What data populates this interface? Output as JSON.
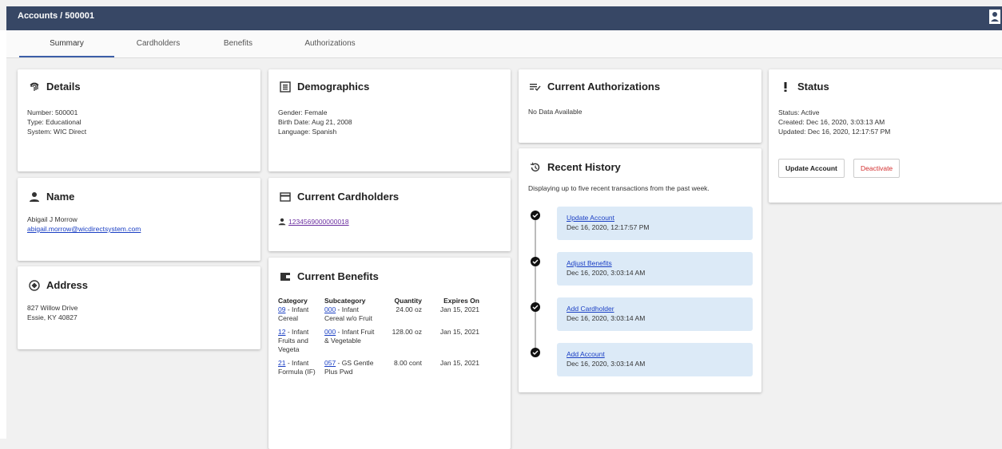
{
  "header": {
    "breadcrumb": "Accounts  /  500001",
    "user_icon": "person-icon"
  },
  "tabs": [
    "Summary",
    "Cardholders",
    "Benefits",
    "Authorizations"
  ],
  "details": {
    "title": "Details",
    "icon": "fingerprint-icon",
    "lines": [
      "Number: 500001",
      "Type:   Educational",
      "System:  WIC Direct"
    ]
  },
  "name": {
    "title": "Name",
    "icon": "person-icon",
    "full_name": "Abigail J Morrow",
    "email": "abigail.morrow@wicdirectsystem.com"
  },
  "address": {
    "title": "Address",
    "icon": "location-icon",
    "line1": "827 Willow Drive",
    "line2": "Essie, KY 40827"
  },
  "demographics": {
    "title": "Demographics",
    "icon": "demographics-icon",
    "lines": [
      "Gender:   Female",
      "Birth Date: Aug 21, 2008",
      "Language: Spanish"
    ]
  },
  "cardholders": {
    "title": "Current Cardholders",
    "icon": "card-icon",
    "items": [
      "1234569000000018"
    ]
  },
  "benefits": {
    "title": "Current Benefits",
    "icon": "wallet-icon",
    "headers": [
      "Category",
      "Subcategory",
      "Quantity",
      "Expires On"
    ],
    "rows": [
      {
        "cat_code": "09",
        "cat_text": " - Infant Cereal",
        "sub_code": "000",
        "sub_text": " - Infant Cereal w/o Fruit",
        "qty": "24.00 oz",
        "exp": "Jan 15, 2021"
      },
      {
        "cat_code": "12",
        "cat_text": " - Infant Fruits and Vegeta",
        "sub_code": "000",
        "sub_text": " - Infant Fruit & Vegetable",
        "qty": "128.00 oz",
        "exp": "Jan 15, 2021"
      },
      {
        "cat_code": "21",
        "cat_text": " - Infant Formula (IF)",
        "sub_code": "057",
        "sub_text": " - GS Gentle Plus Pwd",
        "qty": "8.00 cont",
        "exp": "Jan 15, 2021"
      }
    ]
  },
  "authorizations": {
    "title": "Current Authorizations",
    "icon": "playlist-check-icon",
    "empty": "No Data Available"
  },
  "history": {
    "title": "Recent History",
    "icon": "history-icon",
    "subtitle": "Displaying up to five recent transactions from the past week.",
    "items": [
      {
        "title": "Update Account",
        "date": "Dec 16, 2020, 12:17:57 PM"
      },
      {
        "title": "Adjust Benefits",
        "date": "Dec 16, 2020, 3:03:14 AM"
      },
      {
        "title": "Add Cardholder",
        "date": "Dec 16, 2020, 3:03:14 AM"
      },
      {
        "title": "Add Account",
        "date": "Dec 16, 2020, 3:03:14 AM"
      }
    ]
  },
  "status": {
    "title": "Status",
    "icon": "exclamation-icon",
    "lines": [
      "Status:  Active",
      "Created:  Dec 16, 2020, 3:03:13 AM",
      "Updated: Dec 16, 2020, 12:17:57 PM"
    ],
    "update_label": "Update Account",
    "deactivate_label": "Deactivate",
    "deactivate_color": "#d32f2f"
  }
}
